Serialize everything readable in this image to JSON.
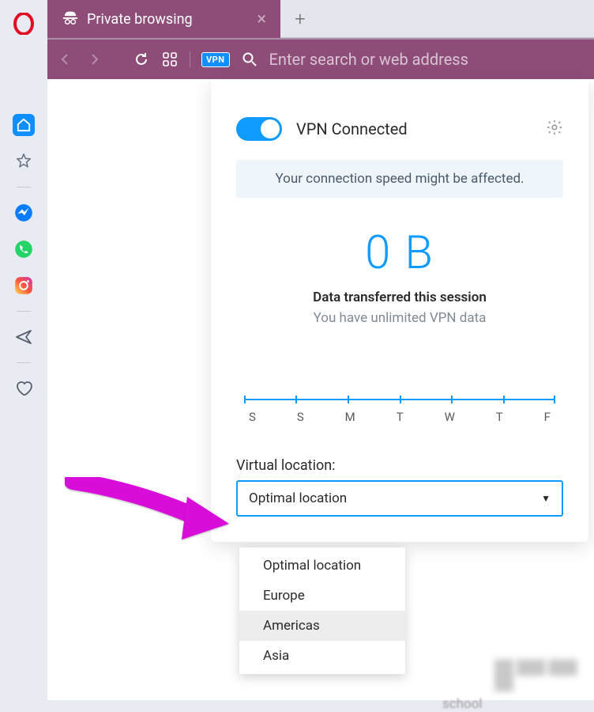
{
  "tab": {
    "title": "Private browsing"
  },
  "addressbar": {
    "vpn_badge": "VPN",
    "placeholder": "Enter search or web address"
  },
  "vpn_panel": {
    "status": "VPN Connected",
    "notice": "Your connection speed might be affected.",
    "data_value": "0 B",
    "data_label": "Data transferred this session",
    "data_sub": "You have unlimited VPN data",
    "virtual_location_label": "Virtual location:",
    "selected": "Optimal location",
    "options": {
      "0": "Optimal location",
      "1": "Europe",
      "2": "Americas",
      "3": "Asia"
    }
  },
  "chart_data": {
    "type": "bar",
    "categories": [
      "S",
      "S",
      "M",
      "T",
      "W",
      "T",
      "F"
    ],
    "values": [
      0,
      0,
      0,
      0,
      0,
      0,
      0
    ],
    "title": "",
    "xlabel": "",
    "ylabel": "",
    "ylim": [
      0,
      1
    ]
  },
  "hidden_text": {
    "school": "school"
  },
  "colors": {
    "accent": "#0f9bff",
    "brand": "#8e4d79",
    "arrow": "#d90dd9"
  }
}
